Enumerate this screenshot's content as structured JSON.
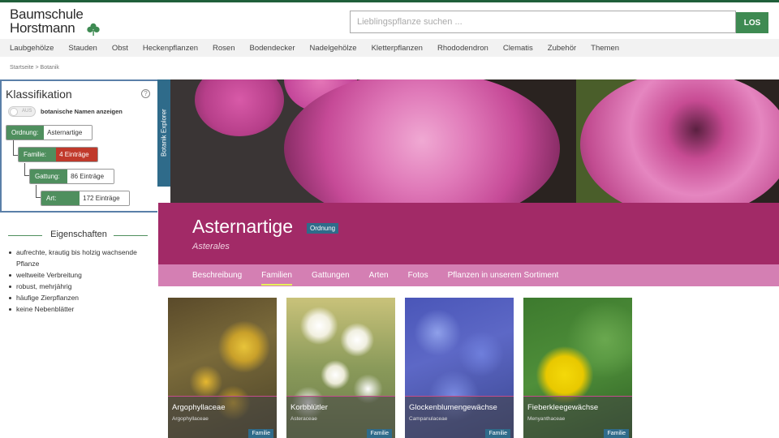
{
  "header": {
    "logo_line1": "Baumschule",
    "logo_line2": "Horstmann",
    "search_placeholder": "Lieblingspflanze suchen ...",
    "search_button": "LOS"
  },
  "nav": [
    "Laubgehölze",
    "Stauden",
    "Obst",
    "Heckenpflanzen",
    "Rosen",
    "Bodendecker",
    "Nadelgehölze",
    "Kletterpflanzen",
    "Rhododendron",
    "Clematis",
    "Zubehör",
    "Themen"
  ],
  "breadcrumb": "Startseite > Botanik",
  "klassifikation": {
    "title": "Klassifikation",
    "toggle_text": "AUS",
    "toggle_label": "botanische Namen anzeigen",
    "rows": [
      {
        "key": "Ordnung:",
        "value": "Asternartige"
      },
      {
        "key": "Familie:",
        "value": "4 Einträge"
      },
      {
        "key": "Gattung:",
        "value": "86 Einträge"
      },
      {
        "key": "Art:",
        "value": "172 Einträge"
      }
    ],
    "explorer_tab": "Botanik Explorer"
  },
  "eigenschaften": {
    "title": "Eigenschaften",
    "items": [
      "aufrechte, krautig bis holzig wachsende Pflanze",
      "weltweite Verbreitung",
      "robust, mehrjährig",
      "häufige Zierpflanzen",
      "keine Nebenblätter"
    ]
  },
  "main": {
    "title": "Asternartige",
    "badge": "Ordnung",
    "subtitle": "Asterales",
    "tabs": [
      "Beschreibung",
      "Familien",
      "Gattungen",
      "Arten",
      "Fotos",
      "Pflanzen in unserem Sortiment"
    ],
    "active_tab": "Familien",
    "cards": [
      {
        "name": "Argophyllaceae",
        "sci": "Argophyllaceae",
        "badge": "Familie"
      },
      {
        "name": "Korbblütler",
        "sci": "Asteraceae",
        "badge": "Familie"
      },
      {
        "name": "Glockenblumengewächse",
        "sci": "Campanulaceae",
        "badge": "Familie"
      },
      {
        "name": "Fieberkleegewächse",
        "sci": "Menyanthaceae",
        "badge": "Familie"
      }
    ]
  },
  "colors": {
    "brand_green": "#3e8a52",
    "title_band": "#a22a67",
    "tab_band": "#d47fb3",
    "badge_blue": "#2f6b8a",
    "highlight_red": "#c0392b"
  }
}
